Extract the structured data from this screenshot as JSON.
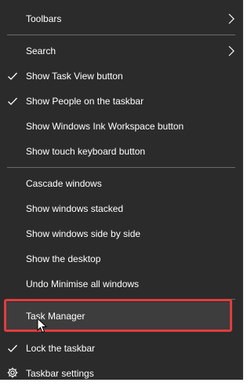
{
  "menu": {
    "toolbars": "Toolbars",
    "search": "Search",
    "show_task_view": "Show Task View button",
    "show_people": "Show People on the taskbar",
    "show_ink": "Show Windows Ink Workspace button",
    "show_touch_keyboard": "Show touch keyboard button",
    "cascade": "Cascade windows",
    "stacked": "Show windows stacked",
    "side_by_side": "Show windows side by side",
    "show_desktop": "Show the desktop",
    "undo_minimise": "Undo Minimise all windows",
    "task_manager": "Task Manager",
    "lock_taskbar": "Lock the taskbar",
    "taskbar_settings": "Taskbar settings"
  },
  "icons": {
    "submenu": "chevron-right-icon",
    "checked": "checkmark-icon",
    "settings": "gear-icon",
    "pointer": "mouse-cursor-icon"
  },
  "colors": {
    "menu_background": "#2b2b2b",
    "text": "#ffffff",
    "separator": "#6a6a6a",
    "hover_background": "#3d3d3d",
    "highlight_border": "#e23c3c"
  }
}
